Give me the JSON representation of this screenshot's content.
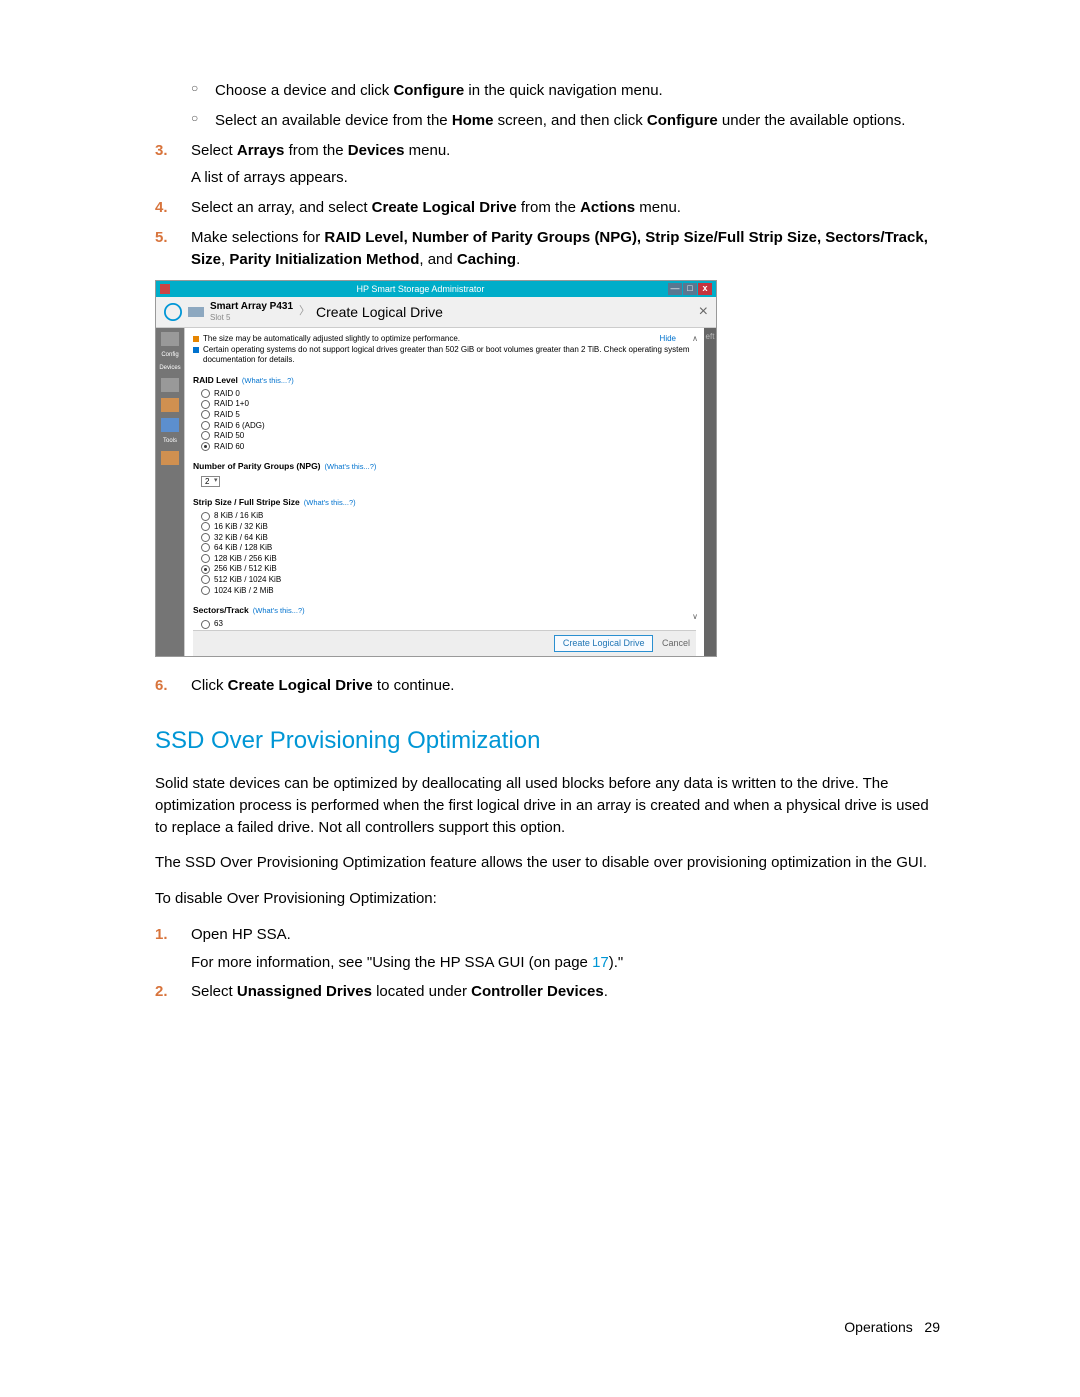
{
  "bullets": {
    "b1_pre": "Choose a device and click ",
    "b1_bold": "Configure",
    "b1_post": " in the quick navigation menu.",
    "b2_pre": "Select an available device from the ",
    "b2_bold1": "Home",
    "b2_mid": " screen, and then click ",
    "b2_bold2": "Configure",
    "b2_post": " under the available options."
  },
  "steps": {
    "s3_num": "3.",
    "s3_pre": "Select ",
    "s3_b1": "Arrays",
    "s3_mid": " from the ",
    "s3_b2": "Devices",
    "s3_post": " menu.",
    "s3_after": "A list of arrays appears.",
    "s4_num": "4.",
    "s4_pre": "Select an array, and select ",
    "s4_b1": "Create Logical Drive",
    "s4_mid": " from the ",
    "s4_b2": "Actions",
    "s4_post": " menu.",
    "s5_num": "5.",
    "s5_pre": "Make selections for ",
    "s5_b1": "RAID Level, Number of Parity Groups (NPG), Strip Size/Full Strip Size, Sectors/Track, Size",
    "s5_mid": ", ",
    "s5_b2": "Parity Initialization Method",
    "s5_mid2": ", and ",
    "s5_b3": "Caching",
    "s5_post": ".",
    "s6_num": "6.",
    "s6_pre": "Click ",
    "s6_b1": "Create Logical Drive",
    "s6_post": " to continue."
  },
  "section": {
    "title": "SSD Over Provisioning Optimization",
    "p1": "Solid state devices can be optimized by deallocating all used blocks before any data is written to the drive. The optimization process is performed when the first logical drive in an array is created and when a physical drive is used to replace a failed drive. Not all controllers support this option.",
    "p2": "The SSD Over Provisioning Optimization feature allows the user to disable over provisioning optimization in the GUI.",
    "p3": "To disable Over Provisioning Optimization:",
    "o1_num": "1.",
    "o1_text": "Open HP SSA.",
    "o1_more_pre": "For more information, see \"Using the HP SSA GUI (on page ",
    "o1_more_link": "17",
    "o1_more_post": ").\"",
    "o2_num": "2.",
    "o2_pre": "Select ",
    "o2_b1": "Unassigned Drives",
    "o2_mid": " located under ",
    "o2_b2": "Controller Devices",
    "o2_post": "."
  },
  "footer": {
    "label": "Operations",
    "page": "29"
  },
  "app": {
    "title": "HP Smart Storage Administrator",
    "breadcrumb_main": "Smart Array P431",
    "breadcrumb_slot": "Slot 5",
    "breadcrumb_page": "Create Logical Drive",
    "hide": "Hide",
    "right_hint": "eft",
    "leftbar": {
      "config": "Config",
      "devices": "Devices",
      "tools": "Tools"
    },
    "notice1": "The size may be automatically adjusted slightly to optimize performance.",
    "notice2": "Certain operating systems do not support logical drives greater than 502 GiB or boot volumes greater than 2 TiB. Check operating system documentation for details.",
    "sec_raid": "RAID Level",
    "sec_npg": "Number of Parity Groups (NPG)",
    "sec_strip": "Strip Size / Full Stripe Size",
    "sec_sectors": "Sectors/Track",
    "whats": "(What's this...?)",
    "raid_opts": [
      "RAID 0",
      "RAID 1+0",
      "RAID 5",
      "RAID 6 (ADG)",
      "RAID 50",
      "RAID 60"
    ],
    "raid_selected_index": 5,
    "npg_value": "2",
    "strip_opts": [
      "8 KiB / 16 KiB",
      "16 KiB / 32 KiB",
      "32 KiB / 64 KiB",
      "64 KiB / 128 KiB",
      "128 KiB / 256 KiB",
      "256 KiB / 512 KiB",
      "512 KiB / 1024 KiB",
      "1024 KiB / 2 MiB"
    ],
    "strip_selected_index": 5,
    "sectors_opt0": "63",
    "btn_create": "Create Logical Drive",
    "btn_cancel": "Cancel"
  }
}
